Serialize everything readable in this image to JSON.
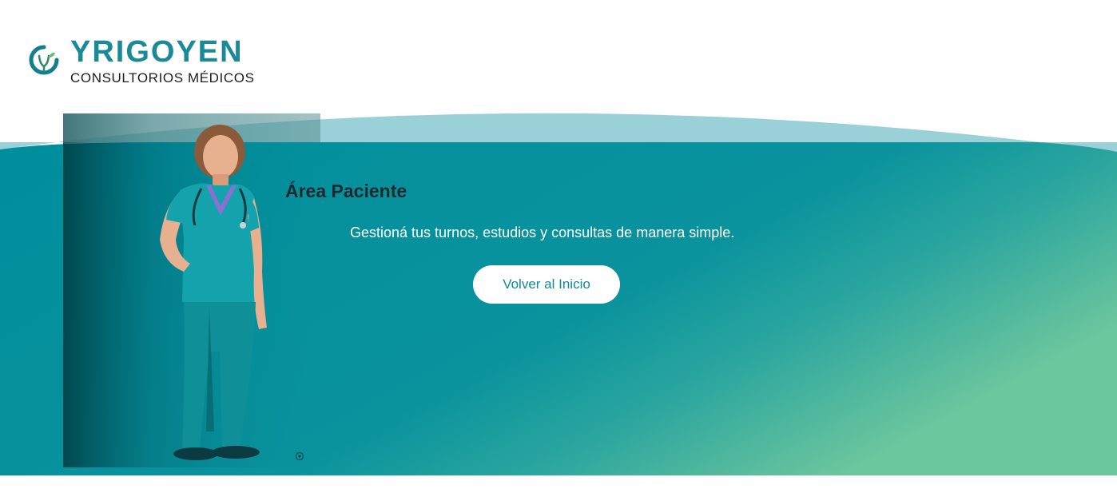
{
  "header": {
    "brand_name": "YRIGOYEN",
    "brand_subtitle": "CONSULTORIOS MÉDICOS",
    "logo_icon": "stethoscope-leaf-logo"
  },
  "hero": {
    "title": "Área Paciente",
    "description": "Gestioná tus turnos, estudios y consultas de manera simple.",
    "back_button_label": "Volver al Inicio",
    "image_alt": "doctor-photo"
  },
  "colors": {
    "brand_teal": "#1a8a99",
    "hero_teal": "#008e9c",
    "hero_green": "#66c39f",
    "arc_light": "#9ad1d8",
    "button_text": "#0f8a97"
  },
  "icons": {
    "corner_icon": "gear-icon"
  }
}
